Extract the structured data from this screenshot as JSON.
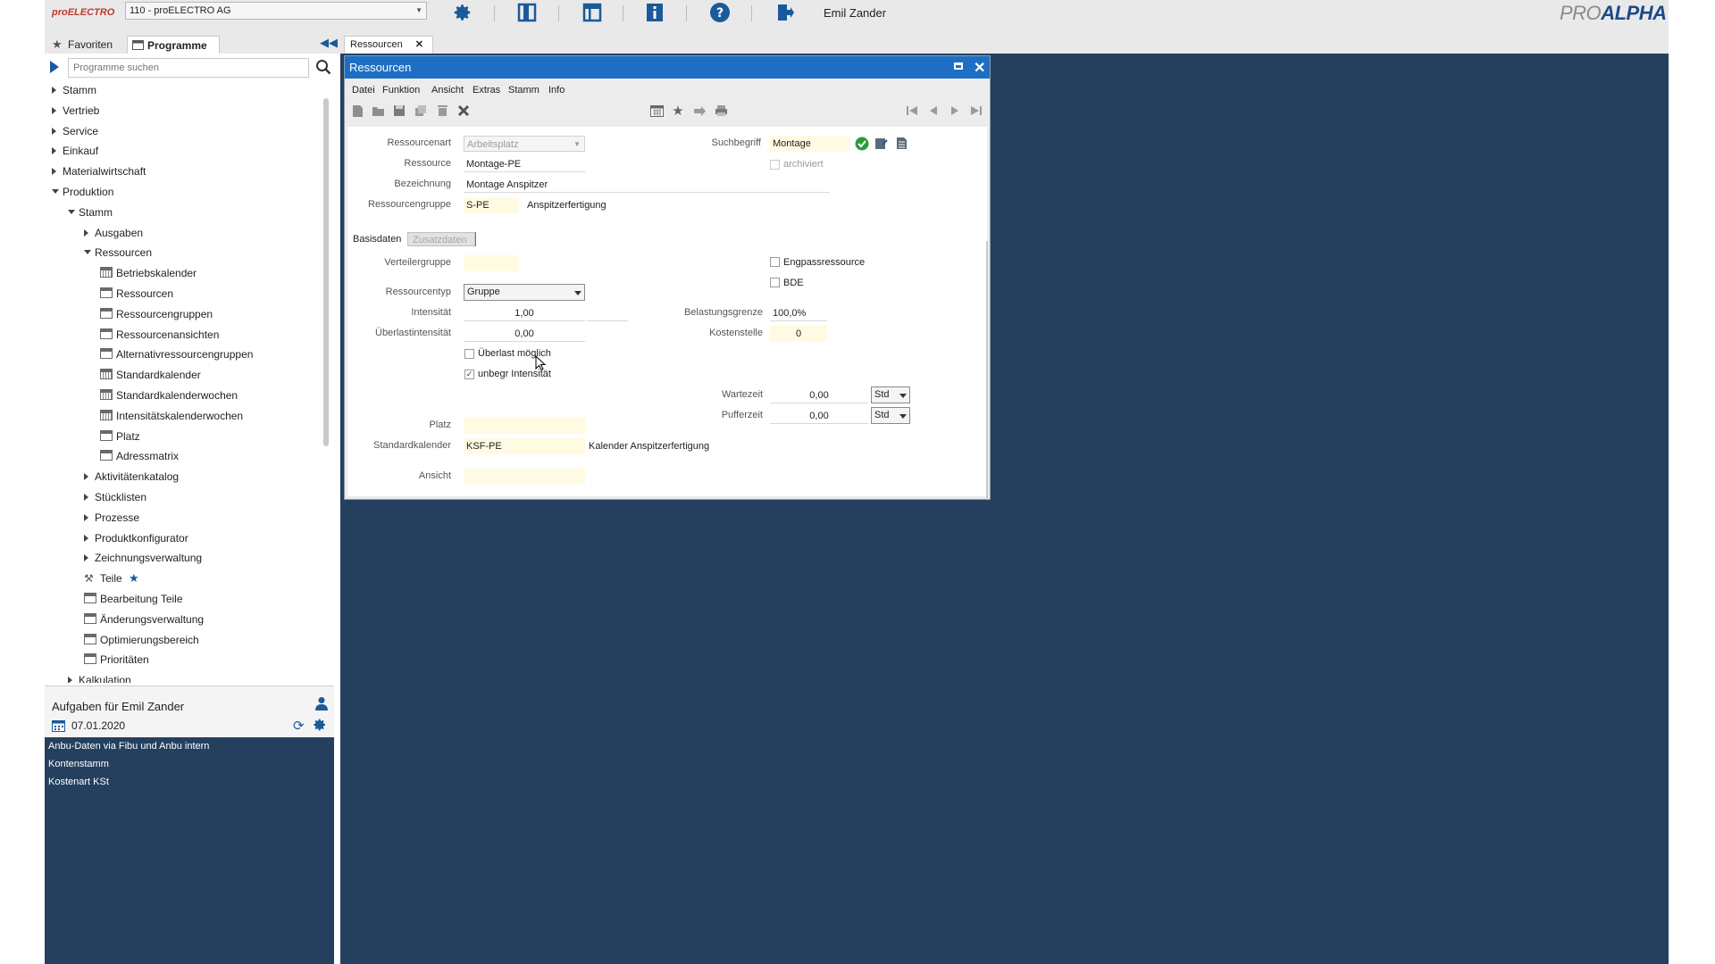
{
  "topbar": {
    "logo": "proELECTRO",
    "company": "110 - proELECTRO AG",
    "username": "Emil Zander",
    "brand_pre": "PRO",
    "brand_post": "ALPHA",
    "icons": [
      "gear-icon",
      "panel-icon",
      "layout-icon",
      "info-icon",
      "help-icon",
      "logout-icon"
    ]
  },
  "left": {
    "tab_favorites": "Favoriten",
    "tab_programs": "Programme",
    "search_placeholder": "Programme suchen",
    "tree": [
      {
        "label": "Stamm",
        "level": 0,
        "toggle": "closed",
        "icon": ""
      },
      {
        "label": "Vertrieb",
        "level": 0,
        "toggle": "closed",
        "icon": ""
      },
      {
        "label": "Service",
        "level": 0,
        "toggle": "closed",
        "icon": ""
      },
      {
        "label": "Einkauf",
        "level": 0,
        "toggle": "closed",
        "icon": ""
      },
      {
        "label": "Materialwirtschaft",
        "level": 0,
        "toggle": "closed",
        "icon": ""
      },
      {
        "label": "Produktion",
        "level": 0,
        "toggle": "open",
        "icon": ""
      },
      {
        "label": "Stamm",
        "level": 1,
        "toggle": "open",
        "icon": ""
      },
      {
        "label": "Ausgaben",
        "level": 2,
        "toggle": "closed",
        "icon": ""
      },
      {
        "label": "Ressourcen",
        "level": 2,
        "toggle": "open",
        "icon": ""
      },
      {
        "label": "Betriebskalender",
        "level": 3,
        "toggle": "",
        "icon": "calendar"
      },
      {
        "label": "Ressourcen",
        "level": 3,
        "toggle": "",
        "icon": "window"
      },
      {
        "label": "Ressourcengruppen",
        "level": 3,
        "toggle": "",
        "icon": "window"
      },
      {
        "label": "Ressourcenansichten",
        "level": 3,
        "toggle": "",
        "icon": "window"
      },
      {
        "label": "Alternativressourcengruppen",
        "level": 3,
        "toggle": "",
        "icon": "window"
      },
      {
        "label": "Standardkalender",
        "level": 3,
        "toggle": "",
        "icon": "calendar"
      },
      {
        "label": "Standardkalenderwochen",
        "level": 3,
        "toggle": "",
        "icon": "calendar"
      },
      {
        "label": "Intensitätskalenderwochen",
        "level": 3,
        "toggle": "",
        "icon": "calendar"
      },
      {
        "label": "Platz",
        "level": 3,
        "toggle": "",
        "icon": "window"
      },
      {
        "label": "Adressmatrix",
        "level": 3,
        "toggle": "",
        "icon": "window"
      },
      {
        "label": "Aktivitätenkatalog",
        "level": 2,
        "toggle": "closed",
        "icon": ""
      },
      {
        "label": "Stücklisten",
        "level": 2,
        "toggle": "closed",
        "icon": ""
      },
      {
        "label": "Prozesse",
        "level": 2,
        "toggle": "closed",
        "icon": ""
      },
      {
        "label": "Produktkonfigurator",
        "level": 2,
        "toggle": "closed",
        "icon": ""
      },
      {
        "label": "Zeichnungsverwaltung",
        "level": 2,
        "toggle": "closed",
        "icon": ""
      },
      {
        "label": "Teile",
        "level": 2,
        "toggle": "",
        "icon": "parts",
        "star": true
      },
      {
        "label": "Bearbeitung Teile",
        "level": 2,
        "toggle": "",
        "icon": "window"
      },
      {
        "label": "Änderungsverwaltung",
        "level": 2,
        "toggle": "",
        "icon": "window"
      },
      {
        "label": "Optimierungsbereich",
        "level": 2,
        "toggle": "",
        "icon": "window"
      },
      {
        "label": "Prioritäten",
        "level": 2,
        "toggle": "",
        "icon": "window"
      },
      {
        "label": "Kalkulation",
        "level": 1,
        "toggle": "closed",
        "icon": ""
      }
    ]
  },
  "tasks": {
    "title": "Aufgaben für Emil Zander",
    "date": "07.01.2020",
    "items": [
      "Anbu-Daten via Fibu und Anbu intern",
      "Kontenstamm",
      "Kostenart KSt"
    ]
  },
  "doc_tab": "Ressourcen",
  "window": {
    "title": "Ressourcen",
    "menu": [
      "Datei",
      "Funktion",
      "Ansicht",
      "Extras",
      "Stamm",
      "Info"
    ]
  },
  "form": {
    "ressourcenart_label": "Ressourcenart",
    "ressourcenart_value": "Arbeitsplatz",
    "ressource_label": "Ressource",
    "ressource_value": "Montage-PE",
    "bezeichnung_label": "Bezeichnung",
    "bezeichnung_value": "Montage Anspitzer",
    "ressourcengruppe_label": "Ressourcengruppe",
    "ressourcengruppe_value": "S-PE",
    "ressourcengruppe_desc": "Anspitzerfertigung",
    "suchbegriff_label": "Suchbegriff",
    "suchbegriff_value": "Montage",
    "archiviert_label": "archiviert",
    "tab_basis": "Basisdaten",
    "tab_zusatz": "Zusatzdaten",
    "verteilergruppe_label": "Verteilergruppe",
    "engpass_label": "Engpassressource",
    "bde_label": "BDE",
    "ressourcentyp_label": "Ressourcentyp",
    "ressourcentyp_value": "Gruppe",
    "intensitaet_label": "Intensität",
    "intensitaet_value": "1,00",
    "ueberlastintensitaet_label": "Überlastintensität",
    "ueberlastintensitaet_value": "0,00",
    "belastungsgrenze_label": "Belastungsgrenze",
    "belastungsgrenze_value": "100,0%",
    "kostenstelle_label": "Kostenstelle",
    "kostenstelle_value": "0",
    "ueberlast_moeglich_label": "Überlast möglich",
    "unbegr_intensitaet_label": "unbegr Intensität",
    "wartezeit_label": "Wartezeit",
    "wartezeit_value": "0,00",
    "wartezeit_unit": "Std",
    "pufferzeit_label": "Pufferzeit",
    "pufferzeit_value": "0,00",
    "pufferzeit_unit": "Std",
    "platz_label": "Platz",
    "standardkalender_label": "Standardkalender",
    "standardkalender_value": "KSF-PE",
    "standardkalender_desc": "Kalender Anspitzerfertigung",
    "ansicht_label": "Ansicht",
    "unbegr_intensitaet_checked": true,
    "ueberlast_moeglich_checked": false
  }
}
